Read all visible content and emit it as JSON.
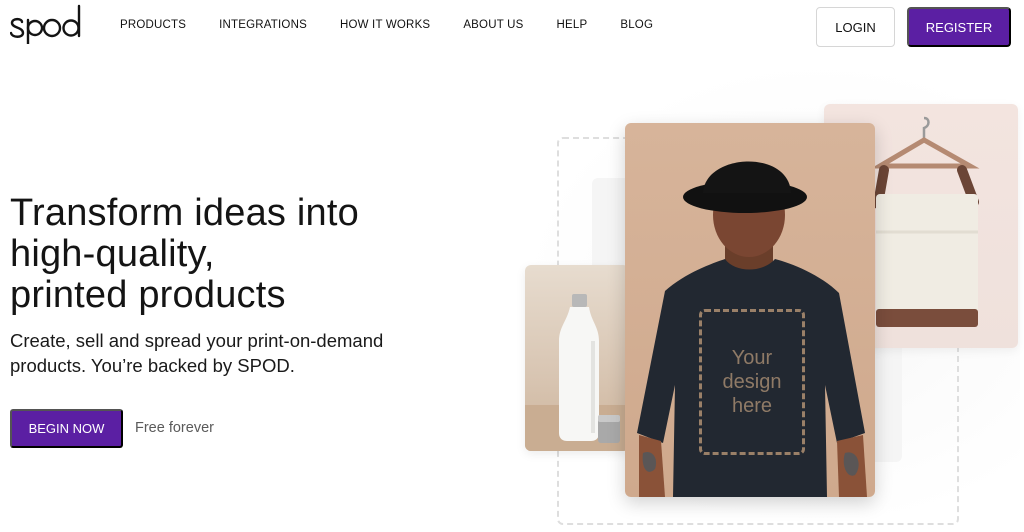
{
  "brand": {
    "logo_text": "spod",
    "color": "#5b1fa3"
  },
  "nav": {
    "items": [
      "PRODUCTS",
      "INTEGRATIONS",
      "HOW IT WORKS",
      "ABOUT US",
      "HELP",
      "BLOG"
    ],
    "login_label": "LOGIN",
    "register_label": "REGISTER"
  },
  "hero": {
    "title_line1": "Transform ideas into",
    "title_line2": "high-quality,",
    "title_line3": "printed products",
    "subtitle_line1": "Create, sell and spread your print-on-demand",
    "subtitle_line2": "products. You’re backed by SPOD.",
    "cta_label": "BEGIN NOW",
    "cta_note": "Free forever"
  },
  "visual": {
    "design_placeholder_line1": "Your",
    "design_placeholder_line2": "design",
    "design_placeholder_line3": "here",
    "products": [
      "water-bottle",
      "t-shirt",
      "tote-bag"
    ]
  }
}
